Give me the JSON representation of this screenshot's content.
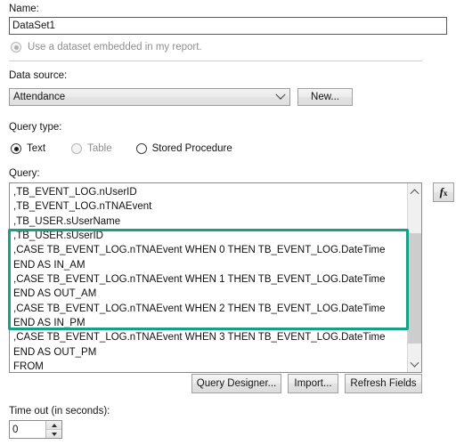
{
  "dialog": {
    "name_label": "Name:",
    "name_value": "DataSet1",
    "embedded_radio_label": "Use a dataset embedded in my report.",
    "datasource_label": "Data source:",
    "datasource_value": "Attendance",
    "new_button": "New...",
    "querytype_label": "Query type:",
    "querytype_options": [
      {
        "label": "Text",
        "selected": true,
        "disabled": false
      },
      {
        "label": "Table",
        "selected": false,
        "disabled": true
      },
      {
        "label": "Stored Procedure",
        "selected": false,
        "disabled": false
      }
    ],
    "query_label": "Query:",
    "query_text": ",TB_EVENT_LOG.nUserID\n,TB_EVENT_LOG.nTNAEvent\n,TB_USER.sUserName\n,TB_USER.sUserID\n,CASE TB_EVENT_LOG.nTNAEvent WHEN 0 THEN TB_EVENT_LOG.DateTime END AS IN_AM\n,CASE TB_EVENT_LOG.nTNAEvent WHEN 1 THEN TB_EVENT_LOG.DateTime END AS OUT_AM\n,CASE TB_EVENT_LOG.nTNAEvent WHEN 2 THEN TB_EVENT_LOG.DateTime END AS IN_PM\n,CASE TB_EVENT_LOG.nTNAEvent WHEN 3 THEN TB_EVENT_LOG.DateTime END AS OUT_PM\nFROM\n  TB_EVENT_LOG\n  INNER JOIN TB_USER\n    ON TB_EVENT_LOG.nUserID = TB_USER.sUserID",
    "expression_button": "fx",
    "query_designer_button": "Query Designer...",
    "import_button": "Import...",
    "refresh_fields_button": "Refresh Fields",
    "timeout_label": "Time out (in seconds):",
    "timeout_value": "0"
  },
  "annotation": {
    "highlight_color": "#16a085",
    "shape": "rectangle-outline"
  },
  "icons": {
    "chevron_down": "chevron-down-icon",
    "scroll_up": "scroll-up-arrow-icon",
    "scroll_down": "scroll-down-arrow-icon",
    "spinner_up": "spinner-up-arrow-icon",
    "spinner_down": "spinner-down-arrow-icon"
  }
}
